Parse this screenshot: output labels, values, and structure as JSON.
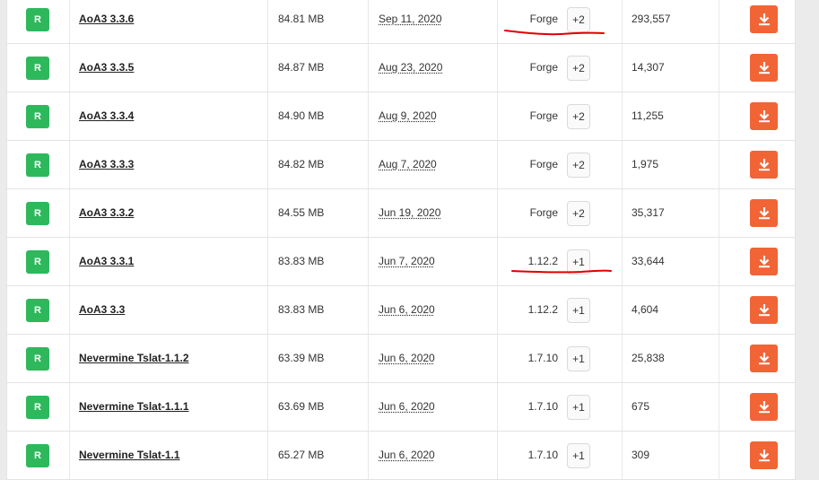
{
  "badge_letter": "R",
  "colors": {
    "badge": "#2eb85c",
    "download_button": "#f16436",
    "annotation": "#e00000"
  },
  "download_icon": "download-arrow-icon",
  "rows": [
    {
      "name": "AoA3 3.3.6",
      "size": "84.81 MB",
      "date": "Sep 11, 2020",
      "version": "Forge",
      "more": "+2",
      "downloads": "293,557"
    },
    {
      "name": "AoA3 3.3.5",
      "size": "84.87 MB",
      "date": "Aug 23, 2020",
      "version": "Forge",
      "more": "+2",
      "downloads": "14,307"
    },
    {
      "name": "AoA3 3.3.4",
      "size": "84.90 MB",
      "date": "Aug 9, 2020",
      "version": "Forge",
      "more": "+2",
      "downloads": "11,255"
    },
    {
      "name": "AoA3 3.3.3",
      "size": "84.82 MB",
      "date": "Aug 7, 2020",
      "version": "Forge",
      "more": "+2",
      "downloads": "1,975"
    },
    {
      "name": "AoA3 3.3.2",
      "size": "84.55 MB",
      "date": "Jun 19, 2020",
      "version": "Forge",
      "more": "+2",
      "downloads": "35,317"
    },
    {
      "name": "AoA3 3.3.1",
      "size": "83.83 MB",
      "date": "Jun 7, 2020",
      "version": "1.12.2",
      "more": "+1",
      "downloads": "33,644"
    },
    {
      "name": "AoA3 3.3",
      "size": "83.83 MB",
      "date": "Jun 6, 2020",
      "version": "1.12.2",
      "more": "+1",
      "downloads": "4,604"
    },
    {
      "name": "Nevermine Tslat-1.1.2",
      "size": "63.39 MB",
      "date": "Jun 6, 2020",
      "version": "1.7.10",
      "more": "+1",
      "downloads": "25,838"
    },
    {
      "name": "Nevermine Tslat-1.1.1",
      "size": "63.69 MB",
      "date": "Jun 6, 2020",
      "version": "1.7.10",
      "more": "+1",
      "downloads": "675"
    },
    {
      "name": "Nevermine Tslat-1.1",
      "size": "65.27 MB",
      "date": "Jun 6, 2020",
      "version": "1.7.10",
      "more": "+1",
      "downloads": "309"
    }
  ]
}
